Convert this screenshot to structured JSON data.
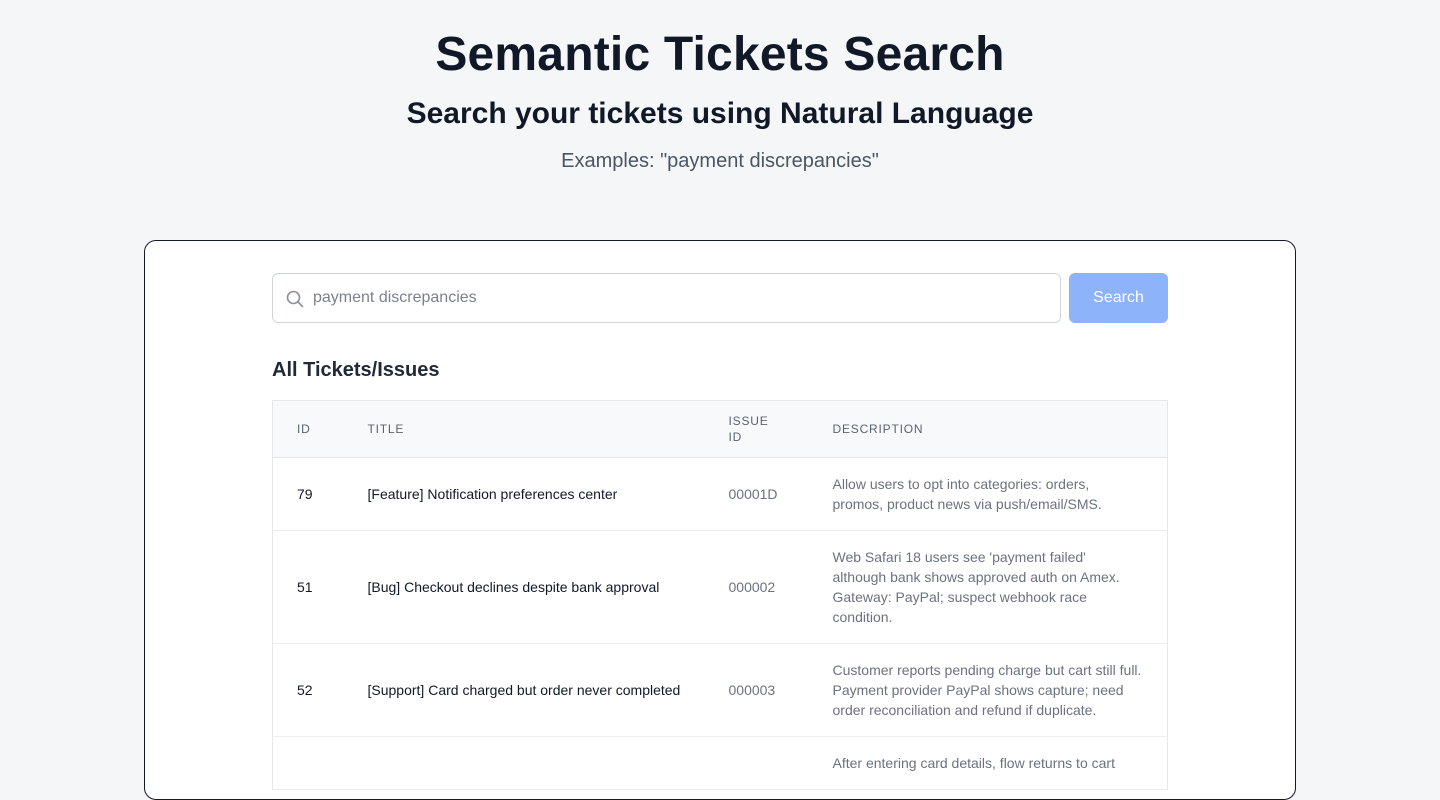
{
  "hero": {
    "title": "Semantic Tickets Search",
    "subtitle": "Search your tickets using Natural Language",
    "examples": "Examples: \"payment discrepancies\""
  },
  "search": {
    "placeholder": "payment discrepancies",
    "value": "",
    "button_label": "Search",
    "icon": "search-icon"
  },
  "colors": {
    "button_bg": "#8db4fb",
    "card_border": "#111827",
    "page_bg": "#f5f6f8"
  },
  "table": {
    "heading": "All Tickets/Issues",
    "columns": {
      "id": "ID",
      "title": "TITLE",
      "issue_line1": "ISSUE",
      "issue_line2": "ID",
      "description": "DESCRIPTION"
    },
    "rows": [
      {
        "id": "79",
        "title": "[Feature] Notification preferences center",
        "issue_id": "00001D",
        "description": "Allow users to opt into categories: orders, promos, product news via push/email/SMS."
      },
      {
        "id": "51",
        "title": "[Bug] Checkout declines despite bank approval",
        "issue_id": "000002",
        "description": "Web Safari 18 users see 'payment failed' although bank shows approved auth on Amex. Gateway: PayPal; suspect webhook race condition."
      },
      {
        "id": "52",
        "title": "[Support] Card charged but order never completed",
        "issue_id": "000003",
        "description": "Customer reports pending charge but cart still full. Payment provider PayPal shows capture; need order reconciliation and refund if duplicate."
      },
      {
        "id": "",
        "title": "",
        "issue_id": "",
        "description": "After entering card details, flow returns to cart"
      }
    ]
  }
}
